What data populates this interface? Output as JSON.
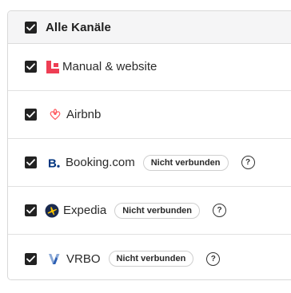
{
  "header": {
    "checked": true,
    "label": "Alle Kanäle"
  },
  "channels": [
    {
      "name": "Manual & website",
      "icon": "manual-website-logo",
      "checked": true,
      "badge": "",
      "help": ""
    },
    {
      "name": "Airbnb",
      "icon": "airbnb-logo",
      "checked": true,
      "badge": "",
      "help": ""
    },
    {
      "name": "Booking.com",
      "icon": "booking-logo",
      "checked": true,
      "badge": "Nicht verbunden",
      "help": "?"
    },
    {
      "name": "Expedia",
      "icon": "expedia-logo",
      "checked": true,
      "badge": "Nicht verbunden",
      "help": "?"
    },
    {
      "name": "VRBO",
      "icon": "vrbo-logo",
      "checked": true,
      "badge": "Nicht verbunden",
      "help": "?"
    }
  ],
  "colors": {
    "checkbox": "#222222",
    "manual_website": "#ee3e54",
    "airbnb": "#ff5a5f",
    "booking": "#003580",
    "expedia_bg": "#1a2a4f",
    "expedia_plane": "#f9c400",
    "vrbo": "#2b5eb3"
  }
}
